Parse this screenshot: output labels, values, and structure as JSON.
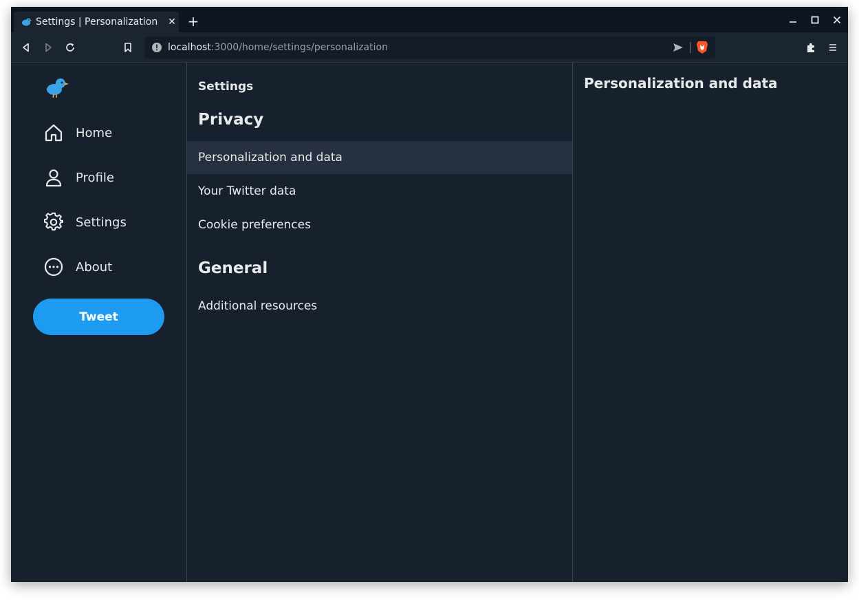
{
  "browser": {
    "tab_title": "Settings | Personalization",
    "tab_close": "✕",
    "new_tab": "+",
    "url_host": "localhost",
    "url_path": ":3000/home/settings/personalization"
  },
  "sidebar": {
    "items": [
      {
        "label": "Home",
        "icon": "home-icon"
      },
      {
        "label": "Profile",
        "icon": "profile-icon"
      },
      {
        "label": "Settings",
        "icon": "gear-icon"
      },
      {
        "label": "About",
        "icon": "more-circle-icon"
      }
    ],
    "tweet_label": "Tweet"
  },
  "settings": {
    "title": "Settings",
    "privacy_heading": "Privacy",
    "privacy_items": [
      "Personalization and data",
      "Your Twitter data",
      "Cookie preferences"
    ],
    "general_heading": "General",
    "general_items": [
      "Additional resources"
    ]
  },
  "detail": {
    "title": "Personalization and data"
  },
  "colors": {
    "accent": "#1d9bf0",
    "background": "#17202d",
    "active_row": "#263040"
  }
}
